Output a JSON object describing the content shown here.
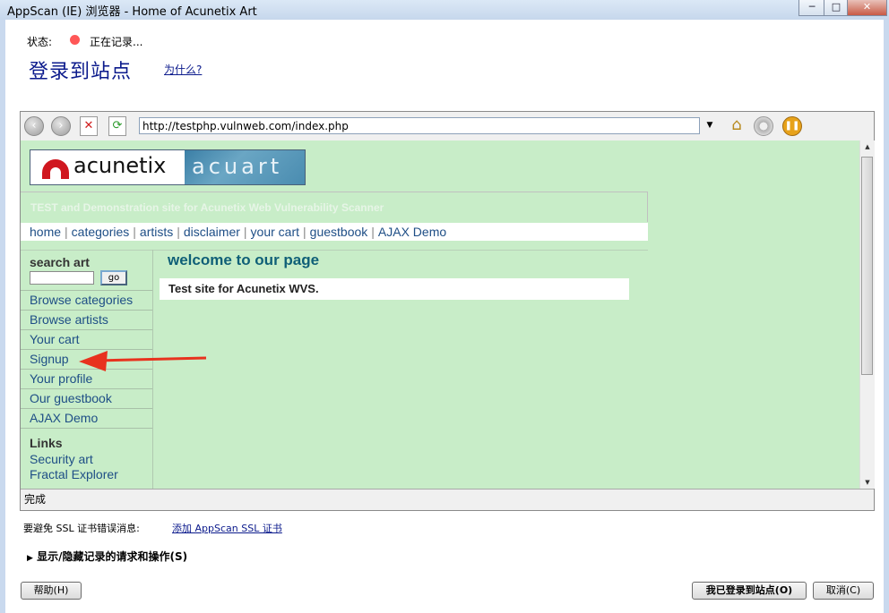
{
  "window": {
    "title": "AppScan (IE) 浏览器 - Home of Acunetix Art",
    "minimize_glyph": "─",
    "maximize_glyph": "□",
    "close_glyph": "✕"
  },
  "status": {
    "label": "状态:",
    "value": "正在记录..."
  },
  "heading": "登录到站点",
  "why_link": "为什么?",
  "browser": {
    "url": "http://testphp.vulnweb.com/index.php",
    "status_text": "完成",
    "icons": [
      "back-icon",
      "forward-icon",
      "stop-icon",
      "refresh-icon",
      "home-icon",
      "stop-record-icon",
      "pause-icon"
    ]
  },
  "site": {
    "logo_left": "acunetix",
    "logo_right": "acuart",
    "tagline": "TEST and Demonstration site for Acunetix Web Vulnerability Scanner",
    "nav": [
      "home",
      "categories",
      "artists",
      "disclaimer",
      "your cart",
      "guestbook",
      "AJAX Demo"
    ],
    "search_label": "search art",
    "go_label": "go",
    "menu": [
      "Browse categories",
      "Browse artists",
      "Your cart",
      "Signup",
      "Your profile",
      "Our guestbook",
      "AJAX Demo"
    ],
    "links_heading": "Links",
    "links": [
      "Security art",
      "Fractal Explorer"
    ],
    "welcome": "welcome to our page",
    "content_text": "Test site for Acunetix WVS."
  },
  "ssl": {
    "label": "要避免 SSL 证书错误消息:",
    "link": "添加 AppScan SSL 证书"
  },
  "toggle_label": "显示/隐藏记录的请求和操作(S)",
  "buttons": {
    "help": "帮助(H)",
    "logged_in": "我已登录到站点(O)",
    "cancel": "取消(C)"
  },
  "colors": {
    "page_bg": "#c8edc8",
    "heading": "#0b1a8c",
    "annotation_arrow": "#e8321e"
  }
}
